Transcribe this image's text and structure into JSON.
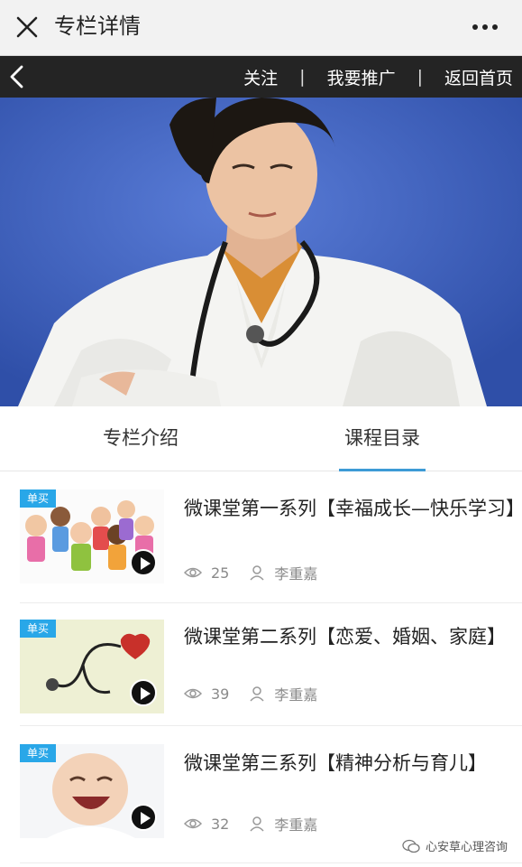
{
  "topbar": {
    "title": "专栏详情"
  },
  "navbar": {
    "follow": "关注",
    "promote": "我要推广",
    "home": "返回首页",
    "separator": "|"
  },
  "tabs": [
    {
      "label": "专栏介绍",
      "active": false
    },
    {
      "label": "课程目录",
      "active": true
    }
  ],
  "courses": [
    {
      "badge": "单买",
      "title": "微课堂第一系列【幸福成长—快乐学习】",
      "views": "25",
      "author": "李重嘉",
      "thumb_icon": "cartoon-kids-image"
    },
    {
      "badge": "单买",
      "title": "微课堂第二系列【恋爱、婚姻、家庭】",
      "views": "39",
      "author": "李重嘉",
      "thumb_icon": "stethoscope-heart-image"
    },
    {
      "badge": "单买",
      "title": "微课堂第三系列【精神分析与育儿】",
      "views": "32",
      "author": "李重嘉",
      "thumb_icon": "laughing-baby-image"
    }
  ],
  "watermark": "心安草心理咨询",
  "colors": {
    "accent": "#3d9bd6",
    "badge": "#29a7e8",
    "navbar": "#242424",
    "hero_bg": "#3f62c4"
  }
}
